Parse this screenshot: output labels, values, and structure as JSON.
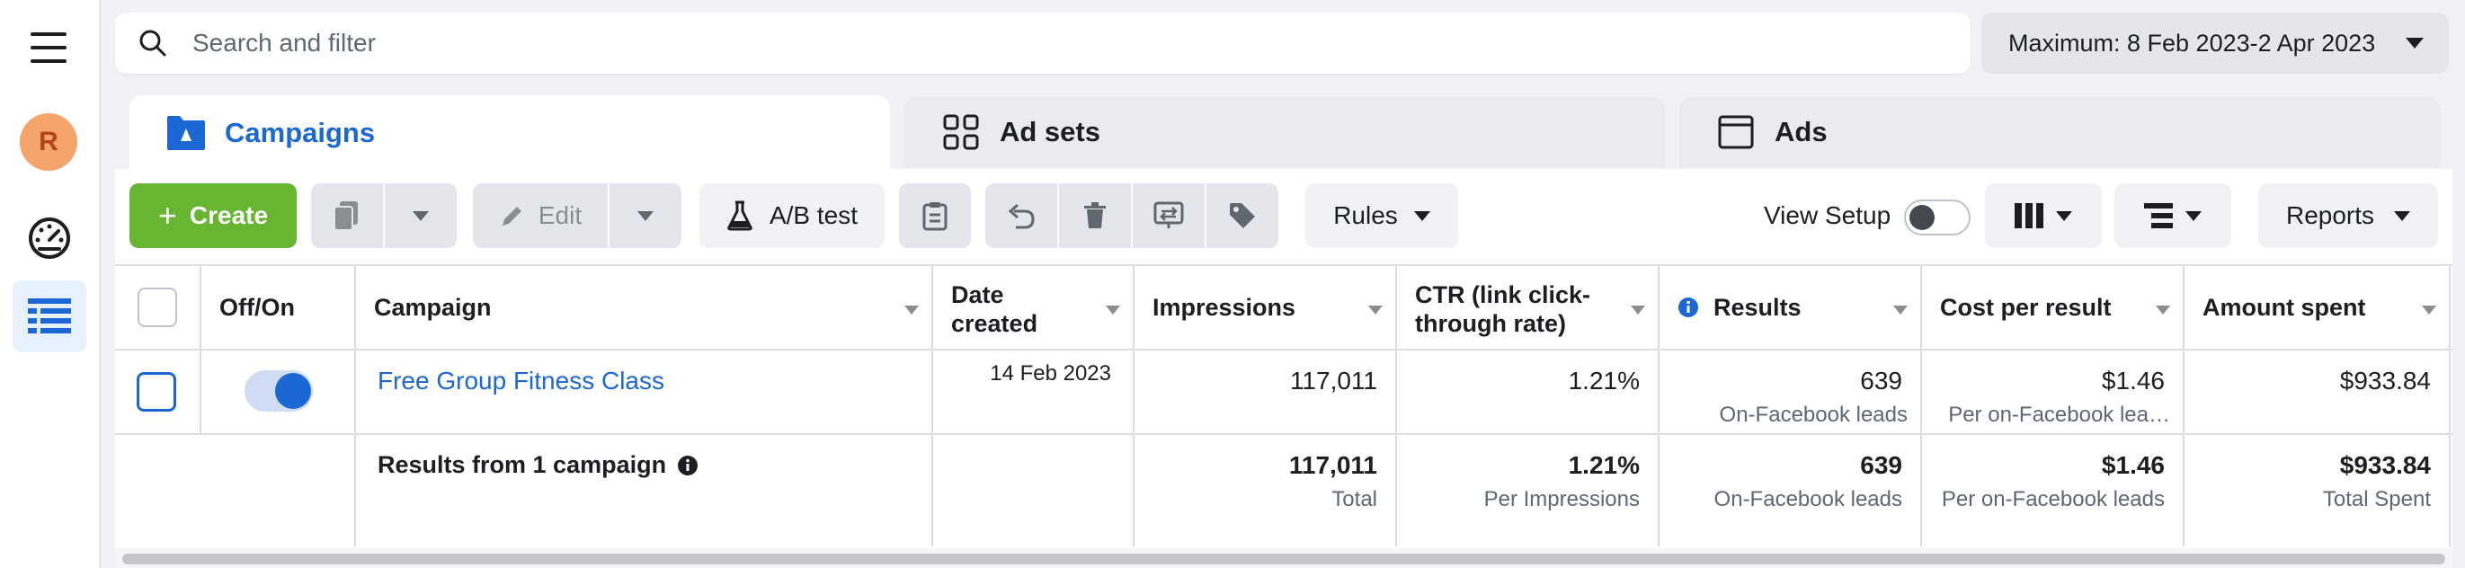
{
  "search": {
    "placeholder": "Search and filter"
  },
  "date_range": {
    "label": "Maximum: 8 Feb 2023-2 Apr 2023"
  },
  "avatar": {
    "initial": "R"
  },
  "tabs": [
    {
      "label": "Campaigns",
      "active": true
    },
    {
      "label": "Ad sets",
      "active": false
    },
    {
      "label": "Ads",
      "active": false
    }
  ],
  "toolbar": {
    "create_label": "Create",
    "edit_label": "Edit",
    "ab_test_label": "A/B test",
    "rules_label": "Rules",
    "view_setup_label": "View Setup",
    "reports_label": "Reports"
  },
  "table": {
    "headers": {
      "off_on": "Off/On",
      "campaign": "Campaign",
      "date_created_1": "Date",
      "date_created_2": "created",
      "impressions": "Impressions",
      "ctr_1": "CTR (link click-",
      "ctr_2": "through rate)",
      "results": "Results",
      "cost_per_result": "Cost per result",
      "amount_spent": "Amount spent"
    },
    "row": {
      "campaign": "Free Group Fitness Class",
      "date_created": "14 Feb 2023",
      "impressions": "117,011",
      "ctr": "1.21%",
      "results": "639",
      "results_sub": "On-Facebook leads",
      "cost_per_result": "$1.46",
      "cost_per_result_sub": "Per on-Facebook lea…",
      "amount_spent": "$933.84"
    },
    "summary": {
      "label": "Results from 1 campaign",
      "impressions": "117,011",
      "impressions_sub": "Total",
      "ctr": "1.21%",
      "ctr_sub": "Per Impressions",
      "results": "639",
      "results_sub": "On-Facebook leads",
      "cost_per_result": "$1.46",
      "cost_per_result_sub": "Per on-Facebook leads",
      "amount_spent": "$933.84",
      "amount_spent_sub": "Total Spent"
    }
  },
  "colors": {
    "accent_blue": "#1b67d6",
    "create_green": "#67b531",
    "avatar_bg": "#f4a56b"
  }
}
